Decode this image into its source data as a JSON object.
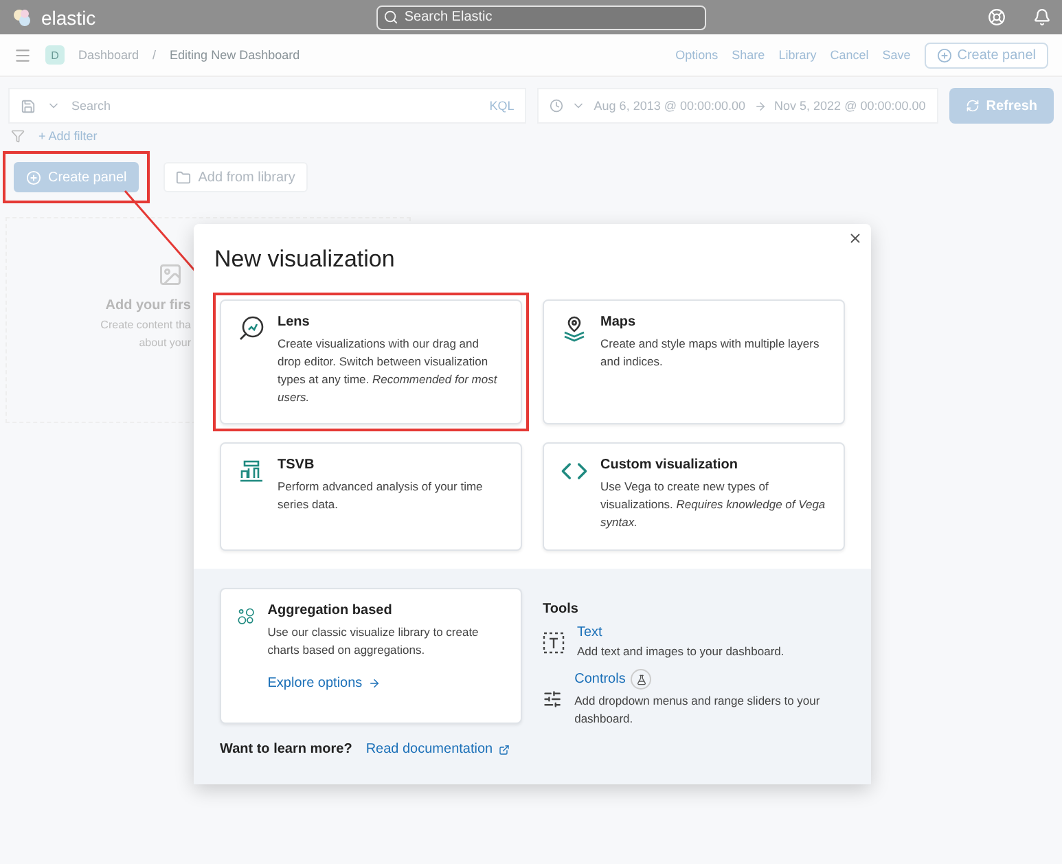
{
  "header": {
    "logo_text": "elastic",
    "search_placeholder": "Search Elastic"
  },
  "nav": {
    "avatar": "D",
    "breadcrumbs": [
      "Dashboard",
      "Editing New Dashboard"
    ],
    "separator": "/",
    "actions": [
      "Options",
      "Share",
      "Library",
      "Cancel",
      "Save"
    ],
    "create_button": "Create panel"
  },
  "query": {
    "placeholder": "Search",
    "language": "KQL",
    "start": "Aug 6, 2013 @ 00:00:00.00",
    "end": "Nov 5, 2022 @ 00:00:00.00",
    "refresh": "Refresh"
  },
  "filter": {
    "add": "+ Add filter"
  },
  "panel_buttons": [
    {
      "kind": "create",
      "label": "Create panel",
      "highlighted": true
    },
    {
      "kind": "library",
      "label": "Add from library",
      "highlighted": false
    }
  ],
  "empty_state": {
    "title": "Add your firs",
    "lines": [
      "Create content tha",
      "about your"
    ]
  },
  "modal": {
    "title": "New visualization",
    "cards": [
      {
        "kind": "lens",
        "title": "Lens",
        "description": "Create visualizations with our drag and drop editor. Switch between visualization types at any time. *Recommended for most users.*",
        "highlighted": true
      },
      {
        "kind": "maps",
        "title": "Maps",
        "description": "Create and style maps with multiple layers and indices.",
        "highlighted": false
      },
      {
        "kind": "tsvb",
        "title": "TSVB",
        "description": "Perform advanced analysis of your time series data.",
        "highlighted": false
      },
      {
        "kind": "custom",
        "title": "Custom visualization",
        "description": "Use Vega to create new types of visualizations. *Requires knowledge of Vega syntax.*",
        "highlighted": false
      }
    ],
    "aggregation": {
      "title": "Aggregation based",
      "description": "Use our classic visualize library to create charts based on aggregations.",
      "link": "Explore options"
    },
    "tools_title": "Tools",
    "tools": [
      {
        "kind": "text",
        "title": "Text",
        "description": "Add text and images to your dashboard.",
        "beta": false
      },
      {
        "kind": "controls",
        "title": "Controls",
        "description": "Add dropdown menus and range sliders to your dashboard.",
        "beta": true
      }
    ],
    "learn_more": "Want to learn more?",
    "doc_link": "Read documentation"
  }
}
